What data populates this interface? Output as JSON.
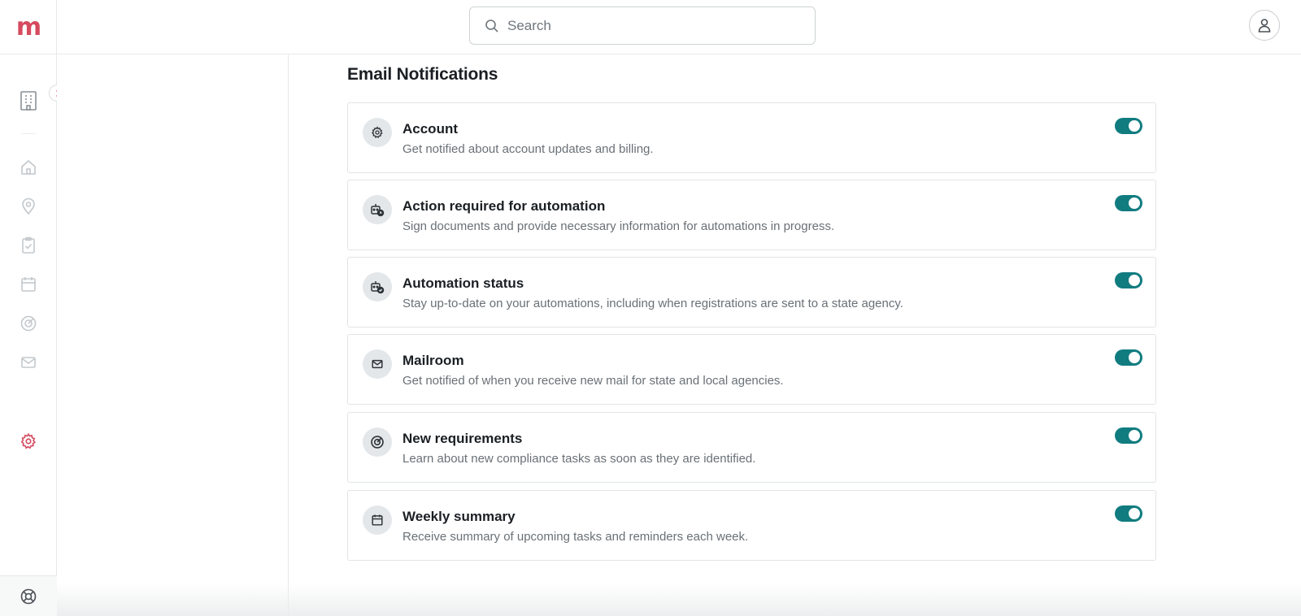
{
  "app": {
    "logo_letter": "m",
    "brand_color": "#d64a5f",
    "accent_color": "#117c80"
  },
  "search": {
    "placeholder": "Search"
  },
  "rail": {
    "items": [
      {
        "icon": "building-icon"
      },
      {
        "icon": "home-icon"
      },
      {
        "icon": "location-pin-icon"
      },
      {
        "icon": "clipboard-check-icon"
      },
      {
        "icon": "calendar-icon"
      },
      {
        "icon": "target-icon"
      },
      {
        "icon": "mail-icon"
      },
      {
        "icon": "gear-icon",
        "active": true
      },
      {
        "icon": "lifebuoy-icon"
      }
    ]
  },
  "section": {
    "title": "Email Notifications"
  },
  "notifications": [
    {
      "icon": "gear-icon",
      "title": "Account",
      "description": "Get notified about account updates and billing.",
      "enabled": true
    },
    {
      "icon": "robot-clock-icon",
      "title": "Action required for automation",
      "description": "Sign documents and provide necessary information for automations in progress.",
      "enabled": true
    },
    {
      "icon": "robot-check-icon",
      "title": "Automation status",
      "description": "Stay up-to-date on your automations, including when registrations are sent to a state agency.",
      "enabled": true
    },
    {
      "icon": "mail-icon",
      "title": "Mailroom",
      "description": "Get notified of when you receive new mail for state and local agencies.",
      "enabled": true
    },
    {
      "icon": "target-icon",
      "title": "New requirements",
      "description": "Learn about new compliance tasks as soon as they are identified.",
      "enabled": true
    },
    {
      "icon": "calendar-icon",
      "title": "Weekly summary",
      "description": "Receive summary of upcoming tasks and reminders each week.",
      "enabled": true
    }
  ]
}
